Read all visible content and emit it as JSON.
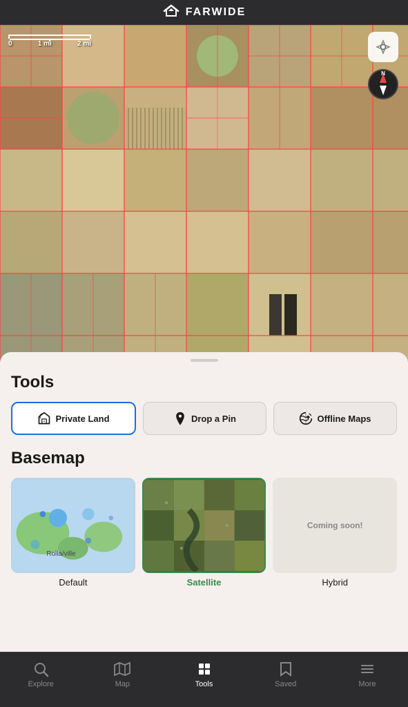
{
  "app": {
    "title": "FARWIDE"
  },
  "header": {
    "logo_symbol": "✕◁",
    "title": "FARWIDE"
  },
  "map": {
    "scale": {
      "label0": "0",
      "label1": "1 mi",
      "label2": "2 mi"
    }
  },
  "tools": {
    "section_title": "Tools",
    "buttons": [
      {
        "id": "private-land",
        "label": "Private Land",
        "active": true
      },
      {
        "id": "drop-pin",
        "label": "Drop a Pin",
        "active": false
      },
      {
        "id": "offline-maps",
        "label": "Offline Maps",
        "active": false
      }
    ]
  },
  "basemap": {
    "section_title": "Basemap",
    "items": [
      {
        "id": "default",
        "label": "Default",
        "selected": false
      },
      {
        "id": "satellite",
        "label": "Satellite",
        "selected": true
      },
      {
        "id": "hybrid",
        "label": "Hybrid",
        "selected": false,
        "coming_soon": "Coming soon!"
      }
    ]
  },
  "nav": {
    "items": [
      {
        "id": "explore",
        "label": "Explore",
        "active": false
      },
      {
        "id": "map",
        "label": "Map",
        "active": false
      },
      {
        "id": "tools",
        "label": "Tools",
        "active": true
      },
      {
        "id": "saved",
        "label": "Saved",
        "active": false
      },
      {
        "id": "more",
        "label": "More",
        "active": false
      }
    ]
  }
}
